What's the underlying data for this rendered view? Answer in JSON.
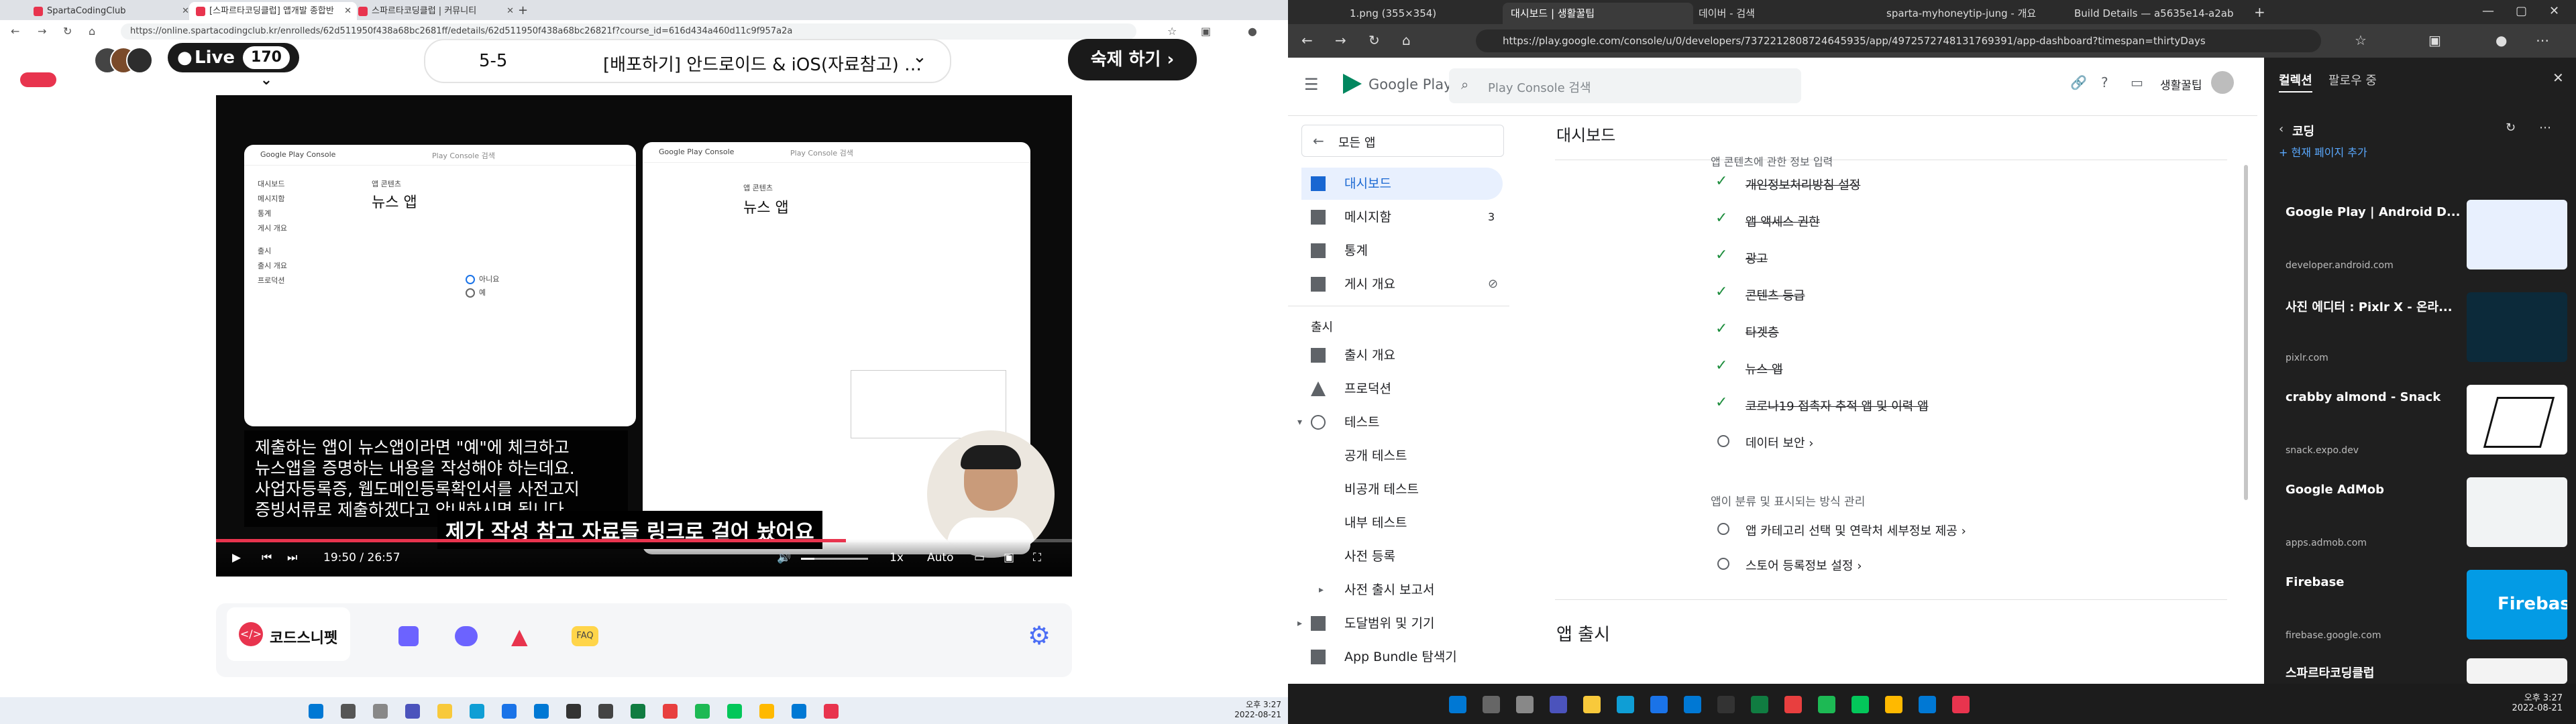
{
  "left_browser": {
    "tabs": [
      {
        "label": "SpartaCodingClub",
        "color": "#e8344e"
      },
      {
        "label": "[스파르타코딩클럽] 앱개발 종합반",
        "color": "#e8344e"
      },
      {
        "label": "스파르타코딩클럽 | 커뮤니티",
        "color": "#e8344e"
      }
    ],
    "url": "https://online.spartacodingclub.kr/enrolleds/62d511950f438a68bc2681ff/edetails/62d511950f438a68bc26821f?course_id=616d434a460d11c9f957a2a"
  },
  "course_page": {
    "live_label": "Live",
    "live_count": "170",
    "lesson_number": "5-5",
    "lesson_title": "[배포하기] 안드로이드 & iOS(자료참고) …",
    "homework_button": "숙제 하기"
  },
  "video": {
    "left_shot": {
      "header": "앱 콘텐츠",
      "title": "뉴스 앱",
      "search": "Play Console 검색",
      "sidebar": [
        "대시보드",
        "메시지함",
        "통계",
        "게시 개요",
        "출시",
        "출시 개요",
        "프로덕션"
      ],
      "option_no": "아니요",
      "option_yes": "예"
    },
    "right_shot": {
      "header": "앱 콘텐츠",
      "title": "뉴스 앱",
      "search": "Play Console 검색"
    },
    "subtitle_lines": [
      "제출하는 앱이 뉴스앱이라면 \"예\"에 체크하고",
      "뉴스앱을 증명하는 내용을 작성해야 하는데요.",
      "사업자등록증, 웹도메인등록확인서를 사전고지",
      "증빙서류로 제출하겠다고 안내하시면 됩니다."
    ],
    "caption": "제가 작성 참고 자료들 링크로 걸어 놨어요",
    "time_current": "19:50",
    "time_total": "26:57",
    "speed": "1x",
    "quality": "Auto",
    "progress": 0.736
  },
  "bottom_tabs": {
    "code_snippet": "코드스니펫",
    "faq": "FAQ"
  },
  "left_clock": {
    "time": "오후 3:27",
    "date": "2022-08-21"
  },
  "right_browser": {
    "tabs": [
      {
        "label": "1.png (355×354)"
      },
      {
        "label": "대시보드 | 생활꿀팁"
      },
      {
        "label": "데이버 - 검색"
      },
      {
        "label": "sparta-myhoneytip-jung - 개요"
      },
      {
        "label": "Build Details — a5635e14-a2ab"
      }
    ],
    "url": "https://play.google.com/console/u/0/developers/7372212808724645935/app/4972572748131769391/app-dashboard?timespan=thirtyDays"
  },
  "play_console": {
    "logo": "Google Play Console",
    "search_placeholder": "Play Console 검색",
    "app_name": "생활꿀팁",
    "all_apps": "모든 앱",
    "page_title": "대시보드",
    "nav": [
      {
        "label": "대시보드",
        "icon": "dashboard-icon",
        "active": true
      },
      {
        "label": "메시지함",
        "icon": "inbox-icon",
        "badge": "3"
      },
      {
        "label": "통계",
        "icon": "stats-icon"
      },
      {
        "label": "게시 개요",
        "icon": "publish-overview-icon"
      }
    ],
    "release_header": "출시",
    "release_nav": [
      {
        "label": "출시 개요",
        "icon": "release-overview-icon"
      },
      {
        "label": "프로덕션",
        "icon": "production-icon"
      },
      {
        "label": "테스트",
        "icon": "test-icon"
      },
      {
        "label": "공개 테스트",
        "icon": ""
      },
      {
        "label": "비공개 테스트",
        "icon": ""
      },
      {
        "label": "내부 테스트",
        "icon": ""
      },
      {
        "label": "사전 등록",
        "icon": ""
      },
      {
        "label": "사전 출시 보고서",
        "icon": ""
      },
      {
        "label": "도달범위 및 기기",
        "icon": "reach-devices-icon"
      },
      {
        "label": "App Bundle 탐색기",
        "icon": "bundle-explorer-icon"
      }
    ],
    "section_top": "앱 콘텐츠에 관한 정보 입력",
    "done_items": [
      "개인정보처리방침 설정",
      "앱 액세스 권한",
      "광고",
      "콘텐츠 등급",
      "타겟층",
      "뉴스 앱",
      "코로나19 접촉자 추적 앱 및 이력 앱"
    ],
    "pending_items": [
      "데이터 보안 ›"
    ],
    "category_header": "앱이 분류 및 표시되는 방식 관리",
    "category_items": [
      "앱 카테고리 선택 및 연락처 세부정보 제공 ›",
      "스토어 등록정보 설정 ›"
    ],
    "release_section": "앱 출시"
  },
  "copilot": {
    "tabs": [
      "컬렉션",
      "팔로우 중"
    ],
    "folder": "코딩",
    "add_current": "현재 페이지 추가",
    "cards": [
      {
        "title": "Google Play | Android D...",
        "domain": "developer.android.com",
        "thumb": "#e8f0fe"
      },
      {
        "title": "사진 에디터 : Pixlr X - 온라...",
        "domain": "pixlr.com",
        "thumb": "#0c2a3a"
      },
      {
        "title": "crabby almond - Snack",
        "domain": "snack.expo.dev",
        "thumb": "#ffffff"
      },
      {
        "title": "Google AdMob",
        "domain": "apps.admob.com",
        "thumb": "#f1f3f4"
      },
      {
        "title": "Firebase",
        "domain": "firebase.google.com",
        "thumb": "#039be5"
      },
      {
        "title": "스파르타코딩클럽",
        "domain": "",
        "thumb": "#f3f3f3"
      }
    ],
    "firebase_logo": "Firebase"
  },
  "right_clock": {
    "time": "오후 3:27",
    "date": "2022-08-21"
  }
}
